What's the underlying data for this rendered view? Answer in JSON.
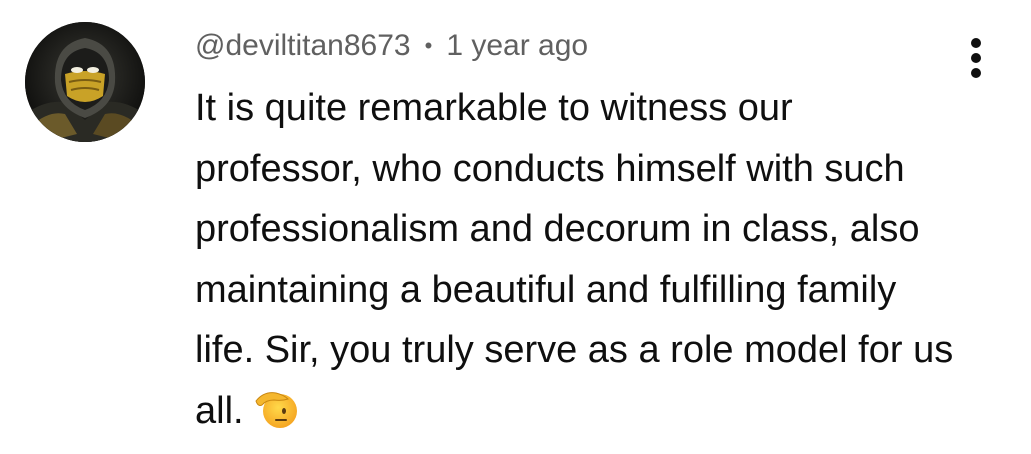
{
  "comment": {
    "author_handle": "@deviltitan8673",
    "separator": "•",
    "timestamp": "1 year ago",
    "text": "It is quite remarkable to witness our professor, who conducts himself with such professionalism and decorum in class, also maintaining a beautiful and fulfilling family life. Sir, you truly serve as a role model for us all.",
    "emoji_icon": "saluting-face-emoji",
    "avatar_icon": "masked-ninja-avatar",
    "menu_icon": "vertical-ellipsis-icon"
  },
  "colors": {
    "text_primary": "#0f0f0f",
    "text_secondary": "#606060",
    "background": "#ffffff"
  }
}
